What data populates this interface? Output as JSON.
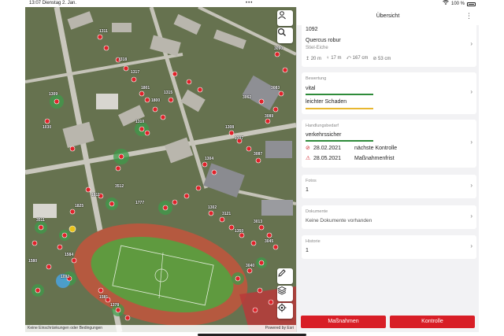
{
  "status": {
    "time_date": "13:07  Dienstag 2. Jan.",
    "dots": "•••",
    "battery": "100 %"
  },
  "map": {
    "footer_left": "Keine Einschränkungen oder Bedingungen",
    "footer_right": "Powered by Esri",
    "tree_labels": [
      "1092",
      "1311",
      "3512",
      "1777",
      "1811",
      "1825",
      "3511",
      "1318",
      "1317",
      "1801",
      "1800",
      "1315",
      "1310",
      "1309",
      "3062",
      "1308",
      "1307",
      "1304",
      "3087",
      "1302",
      "3089",
      "3090",
      "1584",
      "1580",
      "1581",
      "1378",
      "3121",
      "1350",
      "3013",
      "3045",
      "3040",
      "1030",
      "3083"
    ]
  },
  "panel": {
    "title": "Übersicht",
    "tree": {
      "id": "1092",
      "species": "Quercus robur",
      "common_name": "Stiel-Eiche",
      "height": "20 m",
      "crown": "17 m",
      "girth": "167 cm",
      "diameter": "53 cm"
    },
    "bewertung": {
      "label": "Bewertung",
      "vitality": "vital",
      "damage": "leichter Schaden",
      "vitality_color": "#2e8b3a",
      "damage_color": "#e8b730",
      "vitality_level": 1.0,
      "damage_level": 1.0
    },
    "handlungsbedarf": {
      "label": "Handlungsbedarf",
      "status": "verkehrssicher",
      "status_color": "#2e8b3a",
      "control_date": "28.02.2021",
      "control_label": "nächste Kontrolle",
      "measure_date": "28.05.2021",
      "measure_label": "Maßnahmenfrist"
    },
    "fotos": {
      "label": "Fotos",
      "value": "1"
    },
    "dokumente": {
      "label": "Dokumente",
      "value": "Keine Dokumente vorhanden"
    },
    "historie": {
      "label": "Historie",
      "value": "1"
    },
    "buttons": {
      "measures": "Maßnahmen",
      "control": "Kontrolle"
    }
  },
  "accent": "#d81e26"
}
